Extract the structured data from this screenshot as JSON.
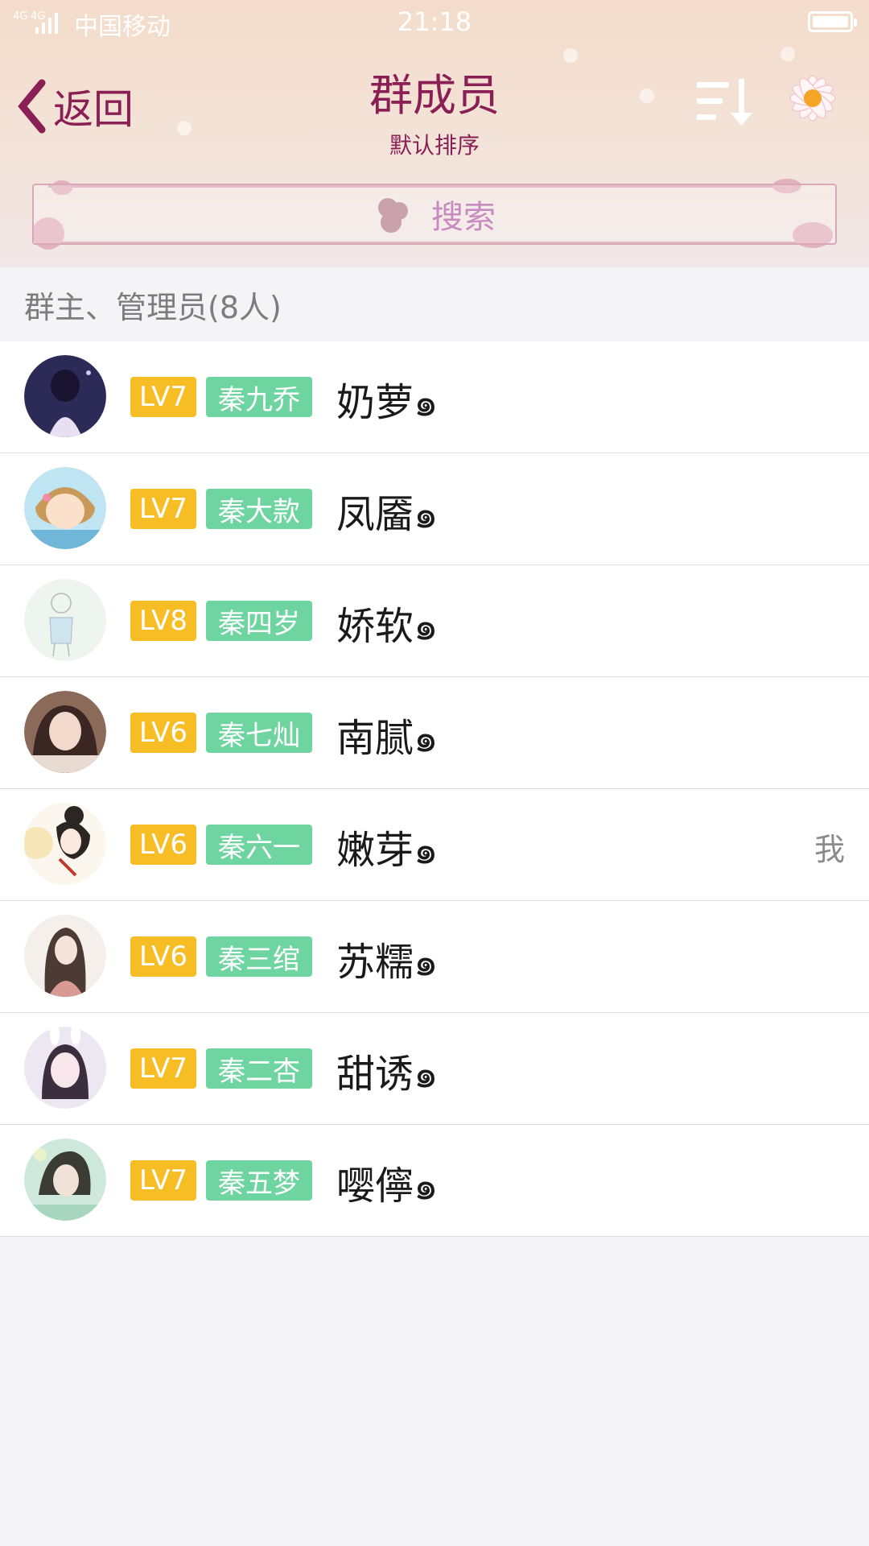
{
  "status_bar": {
    "carrier": "中国移动",
    "time": "21:18",
    "network": "4G 4G"
  },
  "nav": {
    "back_label": "返回",
    "title": "群成员",
    "subtitle": "默认排序",
    "sort_icon": "sort-descending-icon",
    "avatar_icon": "daisy-avatar"
  },
  "search": {
    "placeholder": "搜索"
  },
  "section": {
    "title": "群主、管理员(8人)"
  },
  "members": [
    {
      "level": "LV7",
      "title": "秦九乔",
      "name": "奶萝๑",
      "me": ""
    },
    {
      "level": "LV7",
      "title": "秦大款",
      "name": "凤靥๑",
      "me": ""
    },
    {
      "level": "LV8",
      "title": "秦四岁",
      "name": "娇软๑",
      "me": ""
    },
    {
      "level": "LV6",
      "title": "秦七灿",
      "name": "南腻๑",
      "me": ""
    },
    {
      "level": "LV6",
      "title": "秦六一",
      "name": "嫩芽๑",
      "me": "我"
    },
    {
      "level": "LV6",
      "title": "秦三绾",
      "name": "苏糯๑",
      "me": ""
    },
    {
      "level": "LV7",
      "title": "秦二杏",
      "name": "甜诱๑",
      "me": ""
    },
    {
      "level": "LV7",
      "title": "秦五梦",
      "name": "嘤儜๑",
      "me": ""
    }
  ],
  "colors": {
    "accent": "#8a1f55",
    "level_badge": "#f6bd25",
    "title_badge": "#6fd5a0",
    "search_text": "#c78bbf"
  }
}
